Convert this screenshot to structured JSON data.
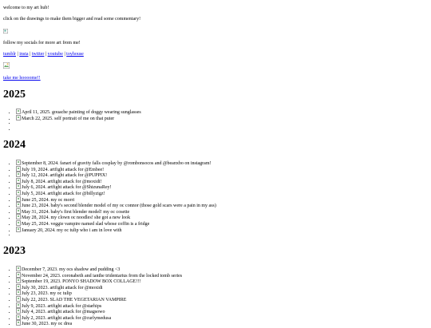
{
  "intro": {
    "welcome": "welcome to my art hub!",
    "instructions": "click on the drawings to make them bigger and read some commentary!",
    "socials_text": "follow my socials for more art from me!",
    "links": [
      "tumblr",
      "insta",
      "twitter",
      "youtube",
      "toyhouse"
    ],
    "separator": "|",
    "home_link": "take me hoooome!!"
  },
  "sections": [
    {
      "year": "2025",
      "items": [
        "April 11, 2025. gouache painting of doggy wearing sunglasses",
        "March 22, 2025. self portrait of me on that puter",
        "",
        ""
      ]
    },
    {
      "year": "2024",
      "items": [
        "September 8, 2024. fanart of gravity falls cosplay by @rombonsocos and @beanxbo on instagram!",
        "July 19, 2024. artfight attack for @Embee!",
        "July 12, 2024. artfight attack for @PUPPIX!",
        "July 8, 2024. artfight attack for @moxidi!",
        "July 6, 2024. artfight attack for @ShizunaRey!",
        "July 5, 2024. artfight attack for @billyzigz!",
        "June 25, 2024. my oc morri",
        "June 23, 2024. baby's second blender model of my oc connor (those gold scars were a pain in my ass)",
        "May 31, 2024. baby's first blender model! my oc cosette",
        "May 28, 2024. my clown oc noodles! she got a new look",
        "May 25, 2024. veggie vampire named slad whose coffin is a fridge",
        "January 20, 2024. my oc tulip who i am in love with",
        ""
      ]
    },
    {
      "year": "2023",
      "items": [
        "December 7, 2023. my ocs shadow and pudding <3",
        "November 24, 2023. coronabeth and ianthe tridentarius from the locked tomb series",
        "September 19, 2023. PONYO SHADOW BOX COLLAGE!!!",
        "July 30, 2023. artfight attack for @moxidi",
        "July 23, 2023. my oc tulip",
        "July 22, 2023. SLAD THE VEGETARIAN VAMPIRE",
        "July 9, 2023. artfight attack for @starhips",
        "July 4, 2023. artfight attack for @magsowo",
        "July 2, 2023. artfight attack for @curlymedusa",
        "June 30, 2023. my oc drea"
      ]
    }
  ]
}
